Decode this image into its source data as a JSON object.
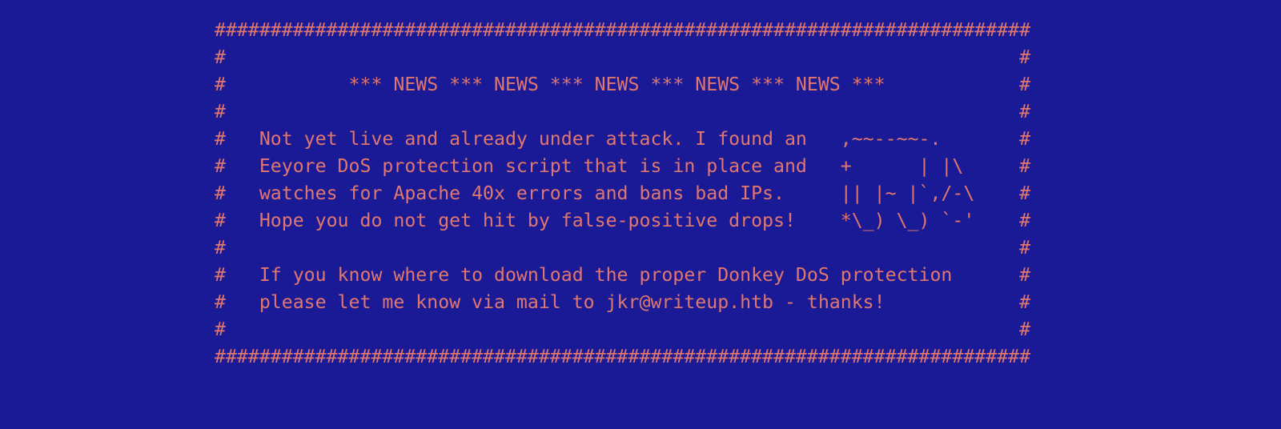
{
  "colors": {
    "background": "#1b1a96",
    "text": "#e0776f"
  },
  "news_box": {
    "lines": [
      "#########################################################################",
      "#                                                                       #",
      "#           *** NEWS *** NEWS *** NEWS *** NEWS *** NEWS ***            #",
      "#                                                                       #",
      "#   Not yet live and already under attack. I found an   ,~~--~~-.       #",
      "#   Eeyore DoS protection script that is in place and   +      | |\\     #",
      "#   watches for Apache 40x errors and bans bad IPs.     || |~ |`,/-\\    #",
      "#   Hope you do not get hit by false-positive drops!    *\\_) \\_) `-'    #",
      "#                                                                       #",
      "#   If you know where to download the proper Donkey DoS protection      #",
      "#   please let me know via mail to jkr@writeup.htb - thanks!            #",
      "#                                                                       #",
      "#########################################################################"
    ]
  }
}
